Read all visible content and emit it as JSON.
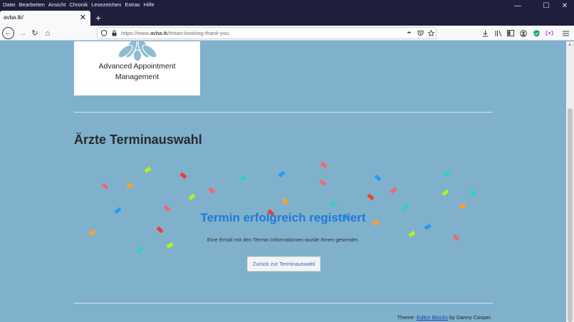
{
  "menu": [
    "Datei",
    "Bearbeiten",
    "Ansicht",
    "Chronik",
    "Lesezeichen",
    "Extras",
    "Hilfe"
  ],
  "window_controls": {
    "minimize": "—",
    "maximize": "☐",
    "close": "✕"
  },
  "tab": {
    "title": "avba.tk/",
    "close": "✕",
    "new": "+"
  },
  "nav": {
    "back": "←",
    "forward": "→",
    "reload": "↻",
    "home": "⌂"
  },
  "url": {
    "prefix": "https://www.",
    "host": "avba.tk",
    "path": "/#start-booking-thank-you",
    "more": "•••"
  },
  "toolbar_icons": [
    "download-icon",
    "library-icon",
    "sidebar-icon",
    "account-icon",
    "shield-extension-icon",
    "extension-icon",
    "menu-icon"
  ],
  "logo": {
    "line1": "Advanced Appointment",
    "line2": "Management"
  },
  "page": {
    "title": "Ärzte Terminauswahl",
    "success_title": "Termin erfolgreich registriert",
    "success_message": "Eine Email mit den Termin Informationen wurde Ihnen gesendet.",
    "back_button": "Zurück zur Terminauswahl"
  },
  "footer": {
    "prefix": "Theme: ",
    "link": "Editor Blocks",
    "suffix": " by Danny Cooper."
  },
  "colors": {
    "page_bg": "#7fb1cd",
    "accent": "#1f7ad6",
    "titlebar": "#1f1e3c"
  }
}
